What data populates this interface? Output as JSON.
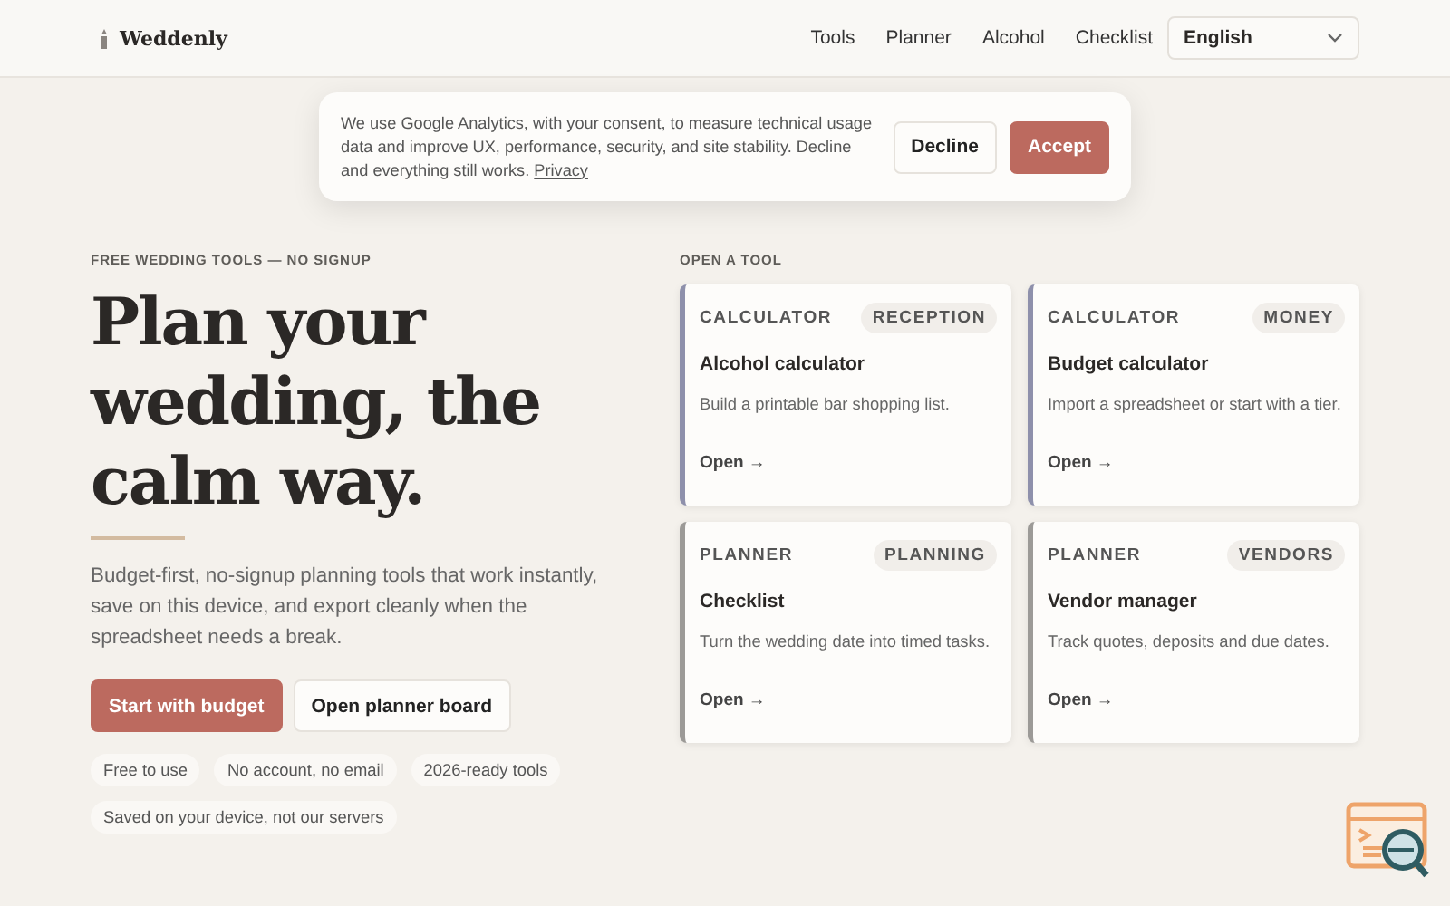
{
  "brand": {
    "name": "Weddenly"
  },
  "nav": [
    {
      "label": "Tools"
    },
    {
      "label": "Planner"
    },
    {
      "label": "Alcohol"
    },
    {
      "label": "Checklist"
    }
  ],
  "language_select": {
    "value": "English"
  },
  "cookie_banner": {
    "text": "We use Google Analytics, with your consent, to measure technical usage data and improve UX, performance, security, and site stability. Decline and everything still works.",
    "link": "Privacy",
    "buttons": [
      {
        "label": "Decline",
        "kind": "secondary"
      },
      {
        "label": "Accept",
        "kind": "primary"
      }
    ]
  },
  "hero": {
    "eyebrow": "FREE WEDDING TOOLS — NO SIGNUP",
    "heading": "Plan your wedding, the calm way.",
    "text": "Budget-first, no-signup planning tools that work instantly, save on this device, and export cleanly when the spreadsheet needs a break.",
    "buttons": [
      {
        "label": "Start with budget",
        "kind": "primary"
      },
      {
        "label": "Open planner board",
        "kind": "secondary"
      }
    ],
    "chips": [
      "Free to use",
      "No account, no email",
      "2026-ready tools",
      "Saved on your device, not our servers"
    ]
  },
  "tools": {
    "title": "OPEN A TOOL",
    "cards": [
      {
        "type": "CALCULATOR",
        "tag": "RECEPTION",
        "title": "Alcohol calculator",
        "text": "Build a printable bar shopping list.",
        "link": "Open →",
        "color": "#8e90ab"
      },
      {
        "type": "CALCULATOR",
        "tag": "MONEY",
        "title": "Budget calculator",
        "text": "Import a spreadsheet or start with a tier.",
        "link": "Open →",
        "color": "#8e90ab"
      },
      {
        "type": "PLANNER",
        "tag": "PLANNING",
        "title": "Checklist",
        "text": "Turn the wedding date into timed tasks.",
        "link": "Open →",
        "color": "#9c9a97"
      },
      {
        "type": "PLANNER",
        "tag": "VENDORS",
        "title": "Vendor manager",
        "text": "Track quotes, deposits and due dates.",
        "link": "Open →",
        "color": "#9c9a97"
      }
    ]
  }
}
